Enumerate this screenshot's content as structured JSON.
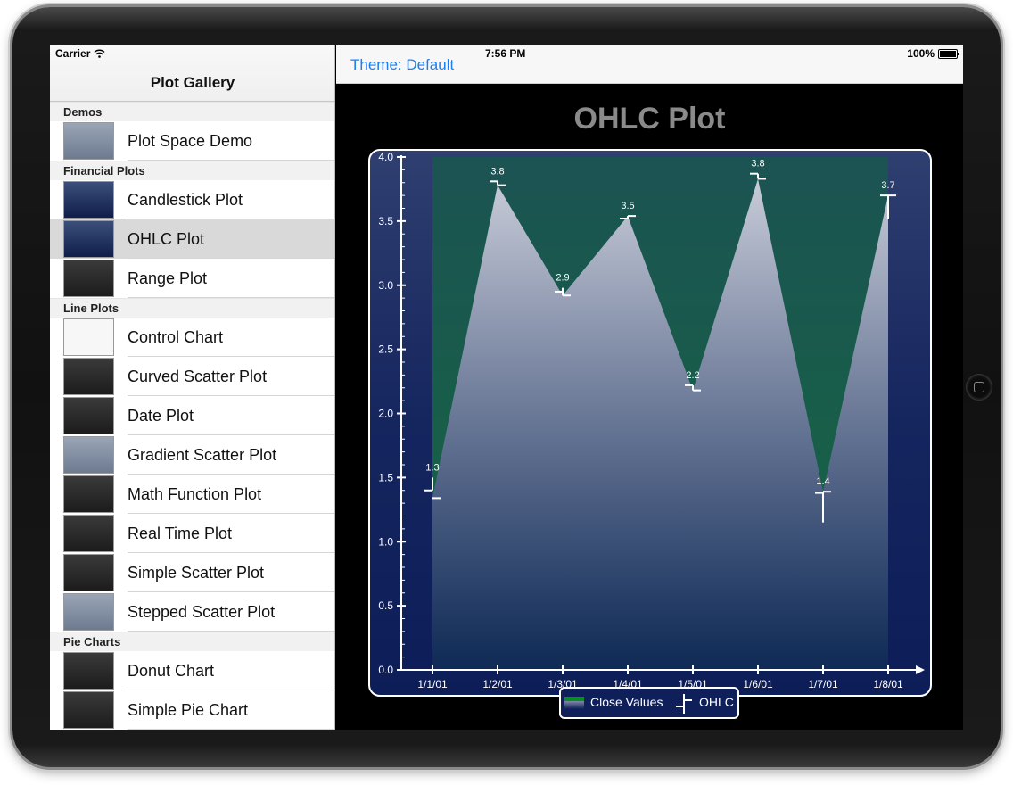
{
  "status_bar": {
    "carrier": "Carrier",
    "time": "7:56 PM",
    "battery": "100%"
  },
  "master": {
    "title": "Plot Gallery",
    "sections": [
      {
        "title": "Demos",
        "items": [
          {
            "label": "Plot Space Demo",
            "thumb": "grey"
          }
        ]
      },
      {
        "title": "Financial Plots",
        "items": [
          {
            "label": "Candlestick Plot",
            "thumb": "blue"
          },
          {
            "label": "OHLC Plot",
            "thumb": "blue",
            "selected": true
          },
          {
            "label": "Range Plot",
            "thumb": "dark"
          }
        ]
      },
      {
        "title": "Line Plots",
        "items": [
          {
            "label": "Control Chart",
            "thumb": "light"
          },
          {
            "label": "Curved Scatter Plot",
            "thumb": "dark"
          },
          {
            "label": "Date Plot",
            "thumb": "dark"
          },
          {
            "label": "Gradient Scatter Plot",
            "thumb": "grey"
          },
          {
            "label": "Math Function Plot",
            "thumb": "dark"
          },
          {
            "label": "Real Time Plot",
            "thumb": "dark"
          },
          {
            "label": "Simple Scatter Plot",
            "thumb": "dark"
          },
          {
            "label": "Stepped Scatter Plot",
            "thumb": "grey"
          }
        ]
      },
      {
        "title": "Pie Charts",
        "items": [
          {
            "label": "Donut Chart",
            "thumb": "dark"
          },
          {
            "label": "Simple Pie Chart",
            "thumb": "dark"
          }
        ]
      }
    ]
  },
  "detail": {
    "theme_button": "Theme: Default"
  },
  "colors": {
    "accent": "#1a7ff0",
    "plot_bg": "#0e1f5a",
    "fill_green": "#0b8a2a",
    "title_grey": "#8a8a8a"
  },
  "chart_data": {
    "type": "line",
    "title": "OHLC Plot",
    "categories": [
      "1/1/01",
      "1/2/01",
      "1/3/01",
      "1/4/01",
      "1/5/01",
      "1/6/01",
      "1/7/01",
      "1/8/01"
    ],
    "ylim": [
      0.0,
      4.0
    ],
    "yticks": [
      "0.0",
      "0.5",
      "1.0",
      "1.5",
      "2.0",
      "2.5",
      "3.0",
      "3.5",
      "4.0"
    ],
    "series": [
      {
        "name": "Close Values",
        "values": [
          1.34,
          3.78,
          2.92,
          3.54,
          2.18,
          3.83,
          1.39,
          3.7
        ]
      },
      {
        "name": "OHLC",
        "ohlc": [
          {
            "open": 1.4,
            "high": 1.5,
            "low": 1.4,
            "close": 1.34
          },
          {
            "open": 3.81,
            "high": 3.81,
            "low": 3.78,
            "close": 3.78
          },
          {
            "open": 2.95,
            "high": 2.98,
            "low": 2.92,
            "close": 2.92
          },
          {
            "open": 3.52,
            "high": 3.54,
            "low": 3.52,
            "close": 3.54
          },
          {
            "open": 2.22,
            "high": 2.22,
            "low": 2.18,
            "close": 2.18
          },
          {
            "open": 3.87,
            "high": 3.87,
            "low": 3.83,
            "close": 3.83
          },
          {
            "open": 1.38,
            "high": 1.39,
            "low": 1.15,
            "close": 1.39
          },
          {
            "open": 3.7,
            "high": 3.7,
            "low": 3.52,
            "close": 3.7
          }
        ]
      }
    ],
    "data_labels": [
      "1.3",
      "3.8",
      "2.9",
      "3.5",
      "2.2",
      "3.8",
      "1.4",
      "3.7"
    ],
    "legend": "bottom-center"
  }
}
